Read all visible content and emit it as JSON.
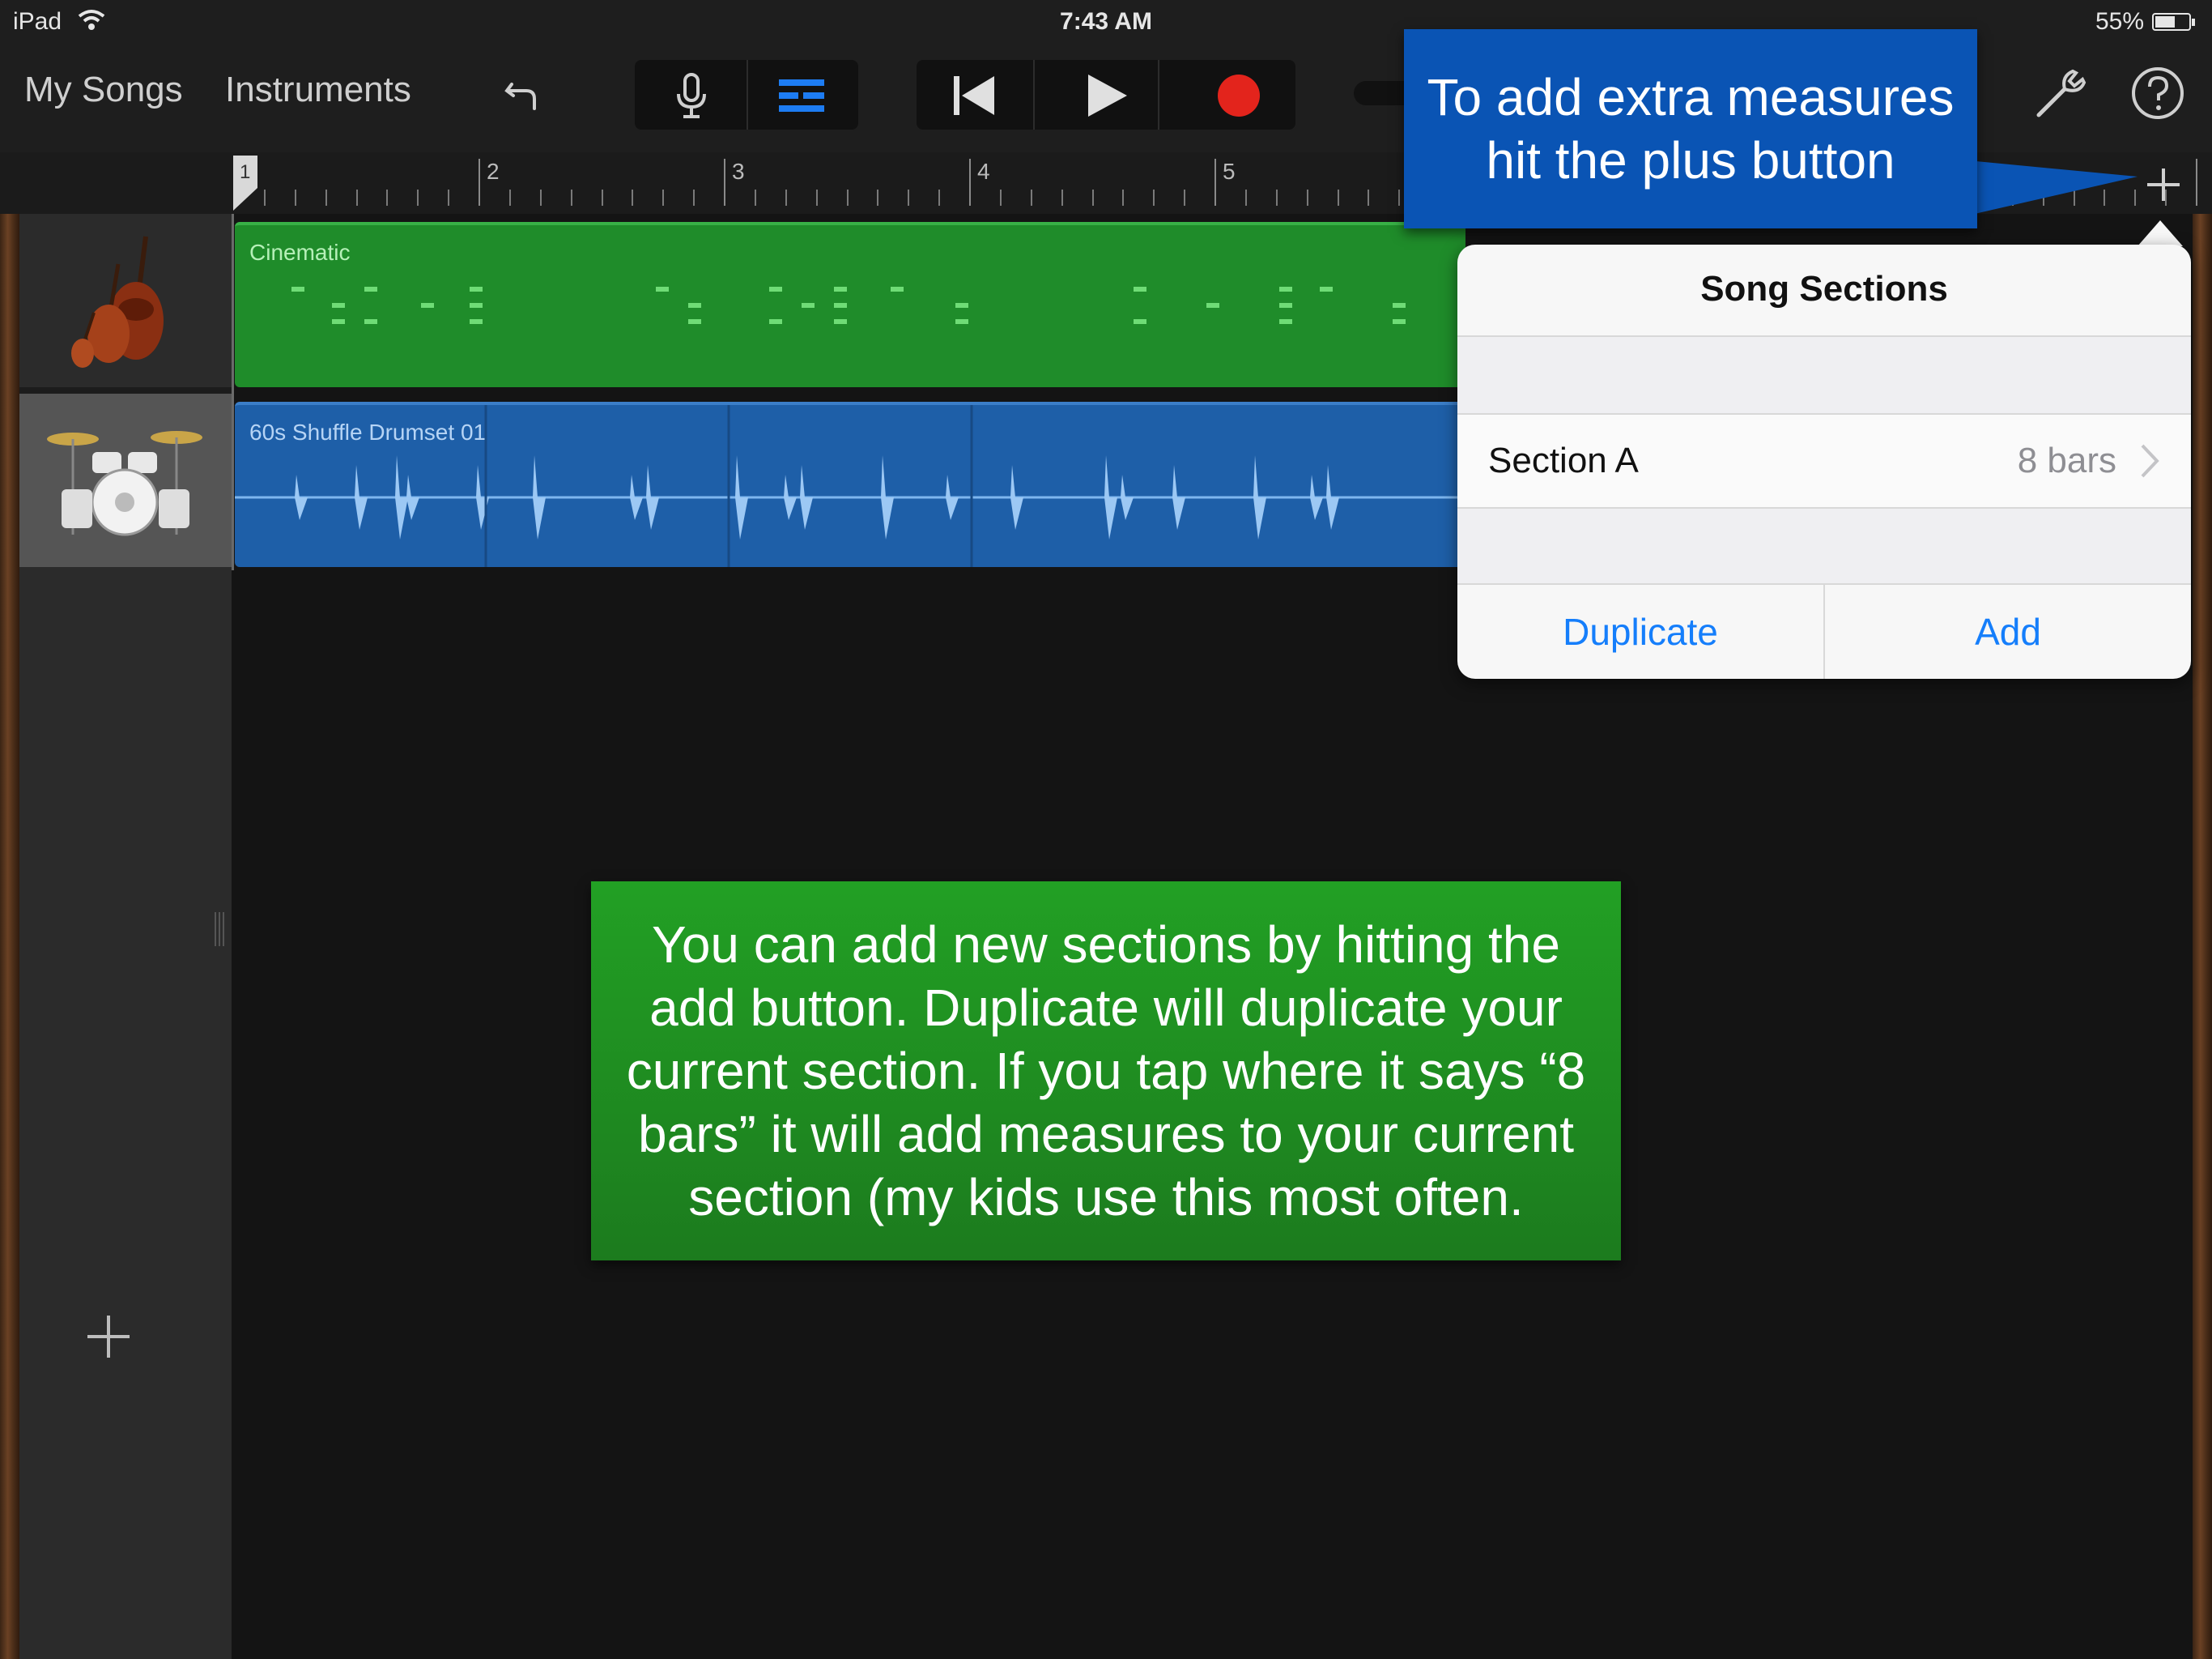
{
  "status_bar": {
    "carrier": "iPad",
    "time": "7:43 AM",
    "battery_percent": "55%",
    "battery_level": 0.55
  },
  "toolbar": {
    "my_songs": "My Songs",
    "instruments": "Instruments",
    "icons": [
      "undo-icon",
      "microphone-icon",
      "tracks-view-icon",
      "go-to-beginning-icon",
      "play-icon",
      "record-icon",
      "settings-wrench-icon",
      "help-icon"
    ],
    "record_color": "#e3241c",
    "active_view_color": "#1d7cf2"
  },
  "ruler": {
    "bar_numbers": [
      "1",
      "2",
      "3",
      "4",
      "5"
    ]
  },
  "tracks": [
    {
      "instrument_icon": "strings-icon",
      "region_label": "Cinematic",
      "region_color": "#1f8c2a"
    },
    {
      "instrument_icon": "drum-kit-icon",
      "region_label": "60s Shuffle Drumset 01",
      "region_color": "#1e5fa8"
    }
  ],
  "popover": {
    "title": "Song Sections",
    "section_name": "Section A",
    "section_length": "8 bars",
    "duplicate_label": "Duplicate",
    "add_label": "Add"
  },
  "callouts": {
    "blue": "To add extra measures hit the plus button",
    "green": "You can add new sections by hitting the add button.  Duplicate will duplicate your current section.  If you tap where it says “8 bars” it will add measures to your current section (my kids use this most often."
  }
}
